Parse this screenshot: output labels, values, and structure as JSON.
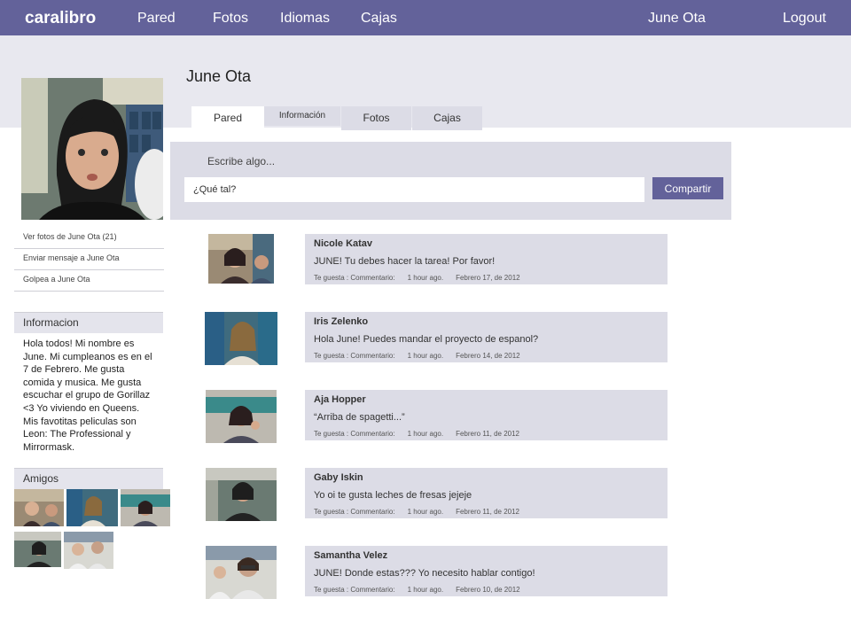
{
  "topbar": {
    "brand": "caralibro",
    "nav": [
      "Pared",
      "Fotos",
      "Idiomas",
      "Cajas"
    ],
    "user": "June Ota",
    "logout": "Logout"
  },
  "profile": {
    "name": "June Ota"
  },
  "sidebar": {
    "links": [
      "Ver fotos de June Ota (21)",
      "Enviar mensaje a June Ota",
      "Golpea a June Ota"
    ],
    "info_header": "Informacion",
    "info_text": "Hola todos! Mi nombre es June. Mi cumpleanos es en el 7 de Febrero. Me gusta comida y musica. Me gusta escuchar el grupo de Gorillaz <3 Yo viviendo en Queens. Mis favotitas peliculas son Leon: The Professional y Mirrormask.",
    "friends_header": "Amigos"
  },
  "tabs": [
    {
      "label": "Pared",
      "active": true
    },
    {
      "label": "Información",
      "active": false
    },
    {
      "label": "Fotos",
      "active": false
    },
    {
      "label": "Cajas",
      "active": false
    }
  ],
  "composer": {
    "prompt": "Escribe algo...",
    "placeholder": "¿Qué tal?",
    "share": "Compartir"
  },
  "posts": [
    {
      "author": "Nicole Katav",
      "message": "JUNE! Tu debes hacer la tarea! Por favor!",
      "like": "Te guesta : Commentario:",
      "time": "1 hour ago.",
      "date": "Febrero 17, de 2012"
    },
    {
      "author": "Iris Zelenko",
      "message": "Hola June! Puedes mandar el proyecto de espanol?",
      "like": "Te guesta : Commentario:",
      "time": "1 hour ago.",
      "date": "Febrero 14, de 2012"
    },
    {
      "author": "Aja Hopper",
      "message": "“Arriba de spagetti...”",
      "like": "Te guesta : Commentario:",
      "time": "1 hour ago.",
      "date": "Febrero 11, de 2012"
    },
    {
      "author": "Gaby Iskin",
      "message": "Yo oi te gusta leches de fresas jejeje",
      "like": "Te guesta : Commentario:",
      "time": "1 hour ago.",
      "date": "Febrero 11, de 2012"
    },
    {
      "author": "Samantha Velez",
      "message": "JUNE! Donde estas??? Yo necesito hablar contigo!",
      "like": "Te guesta : Commentario:",
      "time": "1 hour ago.",
      "date": "Febrero 10, de 2012"
    }
  ],
  "colors": {
    "topbar": "#63629a",
    "band": "#e8e8ef",
    "panel": "#dcdce6"
  }
}
